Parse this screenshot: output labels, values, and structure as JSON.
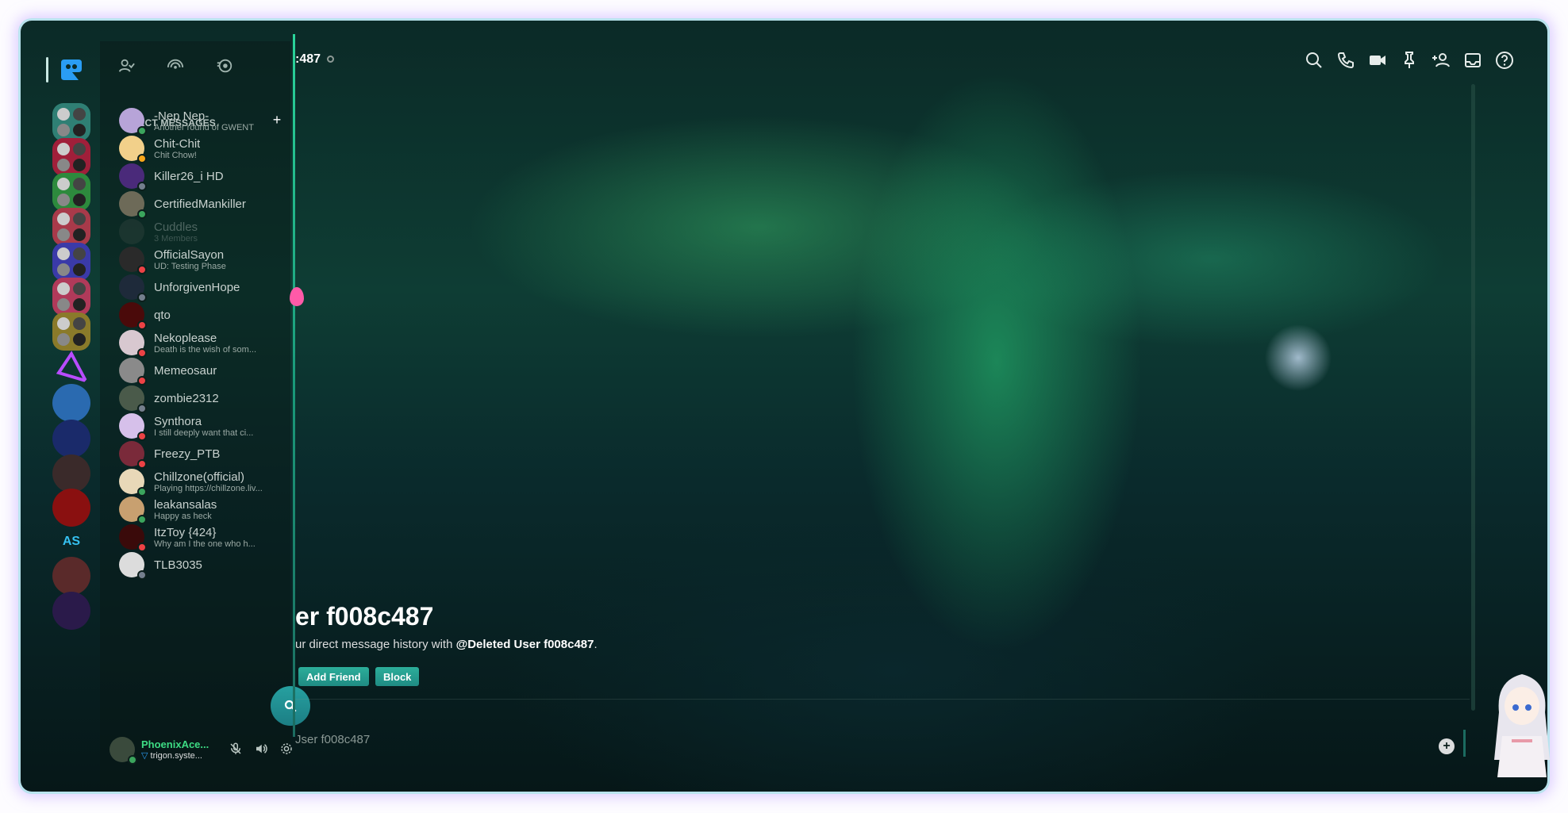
{
  "colors": {
    "accent": "#2ad49a",
    "online": "#3ba55d",
    "idle": "#faa81a",
    "dnd": "#ed4245",
    "offline": "#747f8d",
    "button": "#2cae9a"
  },
  "header": {
    "channel_name": ":487",
    "icons": [
      "search-icon",
      "phone-icon",
      "video-icon",
      "pin-icon",
      "add-friend-icon",
      "inbox-icon",
      "help-icon"
    ]
  },
  "sidebar": {
    "top_icons": [
      "friends-icon",
      "nitro-icon",
      "stage-icon"
    ],
    "dm_header": "DIRECT MESSAGES",
    "dms": [
      {
        "name": "-Nep Nep-",
        "sub": "Another round of GWENT",
        "status": "on",
        "color": "#b7a4d8"
      },
      {
        "name": "Chit-Chit",
        "sub": "Chit Chow!",
        "status": "idle",
        "color": "#f2d08a"
      },
      {
        "name": "Killer26_i HD",
        "sub": "",
        "status": "off",
        "color": "#4a2a7a"
      },
      {
        "name": "CertifiedMankiller",
        "sub": "",
        "status": "on",
        "color": "#6d6a58"
      },
      {
        "name": "Cuddles",
        "sub": "3 Members",
        "status": "",
        "color": "#3a4a44"
      },
      {
        "name": "OfficialSayon",
        "sub": "UD: Testing Phase",
        "status": "dnd",
        "color": "#2a2a2a"
      },
      {
        "name": "UnforgivenHope",
        "sub": "",
        "status": "off",
        "color": "#1e2a3a"
      },
      {
        "name": "qto",
        "sub": "",
        "status": "dnd",
        "color": "#4a0a0a"
      },
      {
        "name": "Nekoplease",
        "sub": "Death is the wish of som...",
        "status": "dnd",
        "color": "#d8c8d0"
      },
      {
        "name": "Memeosaur",
        "sub": "",
        "status": "dnd",
        "color": "#8a8a8a"
      },
      {
        "name": "zombie2312",
        "sub": "",
        "status": "off",
        "color": "#4a5a4a"
      },
      {
        "name": "Synthora",
        "sub": "I still deeply want that ci...",
        "status": "dnd",
        "color": "#d6c0ea"
      },
      {
        "name": "Freezy_PTB",
        "sub": "",
        "status": "dnd",
        "color": "#7a2a3a"
      },
      {
        "name": "Chillzone(official)",
        "sub": "Playing https://chillzone.liv...",
        "status": "on",
        "color": "#e8d8b8"
      },
      {
        "name": "leakansalas",
        "sub": "Happy as heck",
        "status": "on",
        "color": "#c8a070"
      },
      {
        "name": "ItzToy {424}",
        "sub": "Why am I the one who h...",
        "status": "dnd",
        "color": "#3a0a0a"
      },
      {
        "name": "TLB3035",
        "sub": "",
        "status": "off",
        "color": "#dcdcdc"
      }
    ],
    "search_fab": "search-icon"
  },
  "user": {
    "name": "PhoenixAce...",
    "status": "trigon.syste..."
  },
  "welcome": {
    "title": "er f008c487",
    "sub_prefix": "ur direct message history with ",
    "sub_user": "@Deleted User f008c487",
    "sub_suffix": ".",
    "add_friend": "Add Friend",
    "block": "Block"
  },
  "composer": {
    "placeholder": "Jser f008c487"
  },
  "servers": [
    {
      "type": "folder",
      "color": "#2f7f74"
    },
    {
      "type": "folder",
      "color": "#a01f3a"
    },
    {
      "type": "folder",
      "color": "#2d8a3d"
    },
    {
      "type": "folder",
      "color": "#a83a4a"
    },
    {
      "type": "folder",
      "color": "#3a3aa8"
    },
    {
      "type": "folder",
      "color": "#b03a5a"
    },
    {
      "type": "folder",
      "color": "#8a7a2a"
    },
    {
      "type": "icon",
      "color": "transparent"
    },
    {
      "type": "icon",
      "color": "#2a6ab0"
    },
    {
      "type": "icon",
      "color": "#1a2a6a"
    },
    {
      "type": "icon",
      "color": "#3a2a2a"
    },
    {
      "type": "icon",
      "color": "#8a1010"
    },
    {
      "type": "text",
      "color": "transparent",
      "label": "AS"
    },
    {
      "type": "icon",
      "color": "#5a2a2a"
    },
    {
      "type": "icon",
      "color": "#2a1a4a"
    }
  ]
}
